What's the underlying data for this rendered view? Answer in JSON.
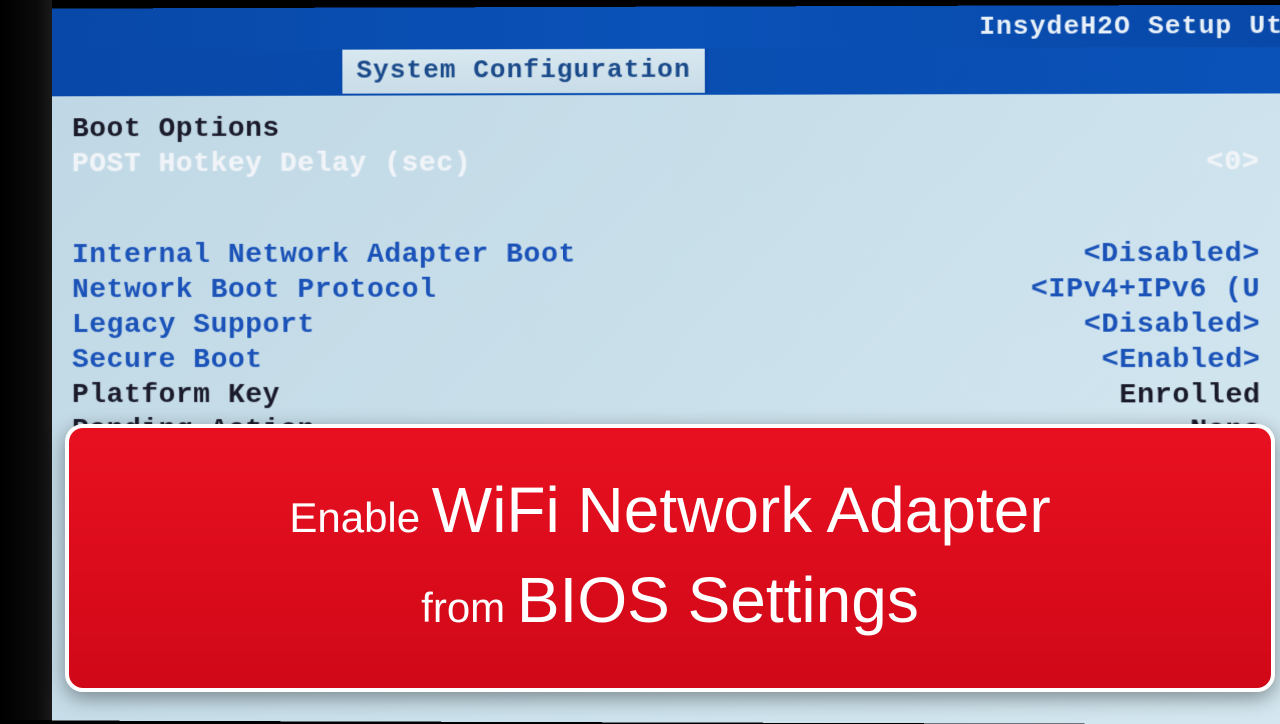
{
  "title": "InsydeH2O Setup Ut",
  "tab": "System Configuration",
  "rows": [
    {
      "label": "Boot Options",
      "value": "",
      "labelClass": "black",
      "valueClass": ""
    },
    {
      "label": "POST Hotkey Delay (sec)",
      "value": "<0>",
      "labelClass": "white",
      "valueClass": "white"
    }
  ],
  "rows2": [
    {
      "label": "Internal Network Adapter Boot",
      "value": "<Disabled>",
      "labelClass": "blue",
      "valueClass": "blue"
    },
    {
      "label": "Network Boot Protocol",
      "value": "<IPv4+IPv6 (U",
      "labelClass": "blue",
      "valueClass": "blue"
    },
    {
      "label": "Legacy Support",
      "value": "<Disabled>",
      "labelClass": "blue",
      "valueClass": "blue"
    },
    {
      "label": "Secure Boot",
      "value": "<Enabled>",
      "labelClass": "blue",
      "valueClass": "blue"
    },
    {
      "label": "Platform Key",
      "value": "Enrolled",
      "labelClass": "black",
      "valueClass": "black"
    },
    {
      "label": "Pending Action",
      "value": "None",
      "labelClass": "black",
      "valueClass": "black"
    }
  ],
  "banner": {
    "pre1": "Enable ",
    "big1": "WiFi Network Adapter",
    "pre2": "from ",
    "big2": "BIOS Settings"
  }
}
